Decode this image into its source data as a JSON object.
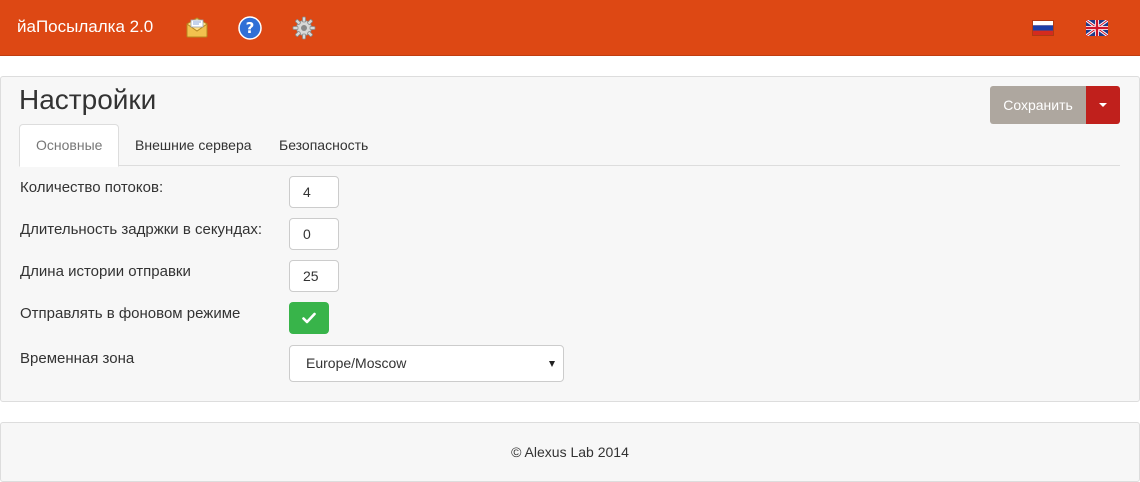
{
  "navbar": {
    "brand": "йаПосылалка 2.0",
    "icons": [
      "envelope-icon",
      "help-icon",
      "gear-icon"
    ],
    "languages": [
      "flag-ru-icon",
      "flag-uk-icon"
    ],
    "color": "#dd4814"
  },
  "page": {
    "title": "Настройки",
    "save_label": "Сохранить"
  },
  "tabs": [
    {
      "label": "Основные",
      "active": true
    },
    {
      "label": "Внешние сервера",
      "active": false
    },
    {
      "label": "Безопасность",
      "active": false
    }
  ],
  "fields": {
    "threads": {
      "label": "Количество потоков:",
      "value": "4"
    },
    "delay": {
      "label": "Длительность задржки в секундах:",
      "value": "0"
    },
    "history": {
      "label": "Длина истории отправки",
      "value": "25"
    },
    "background": {
      "label": "Отправлять в фоновом режиме",
      "checked": true
    },
    "timezone": {
      "label": "Временная зона",
      "value": "Europe/Moscow"
    }
  },
  "footer": {
    "text": "© Alexus Lab 2014"
  },
  "colors": {
    "accent": "#dd4814",
    "save": "#aea79f",
    "save_caret": "#c0201c",
    "success": "#38b44a"
  }
}
